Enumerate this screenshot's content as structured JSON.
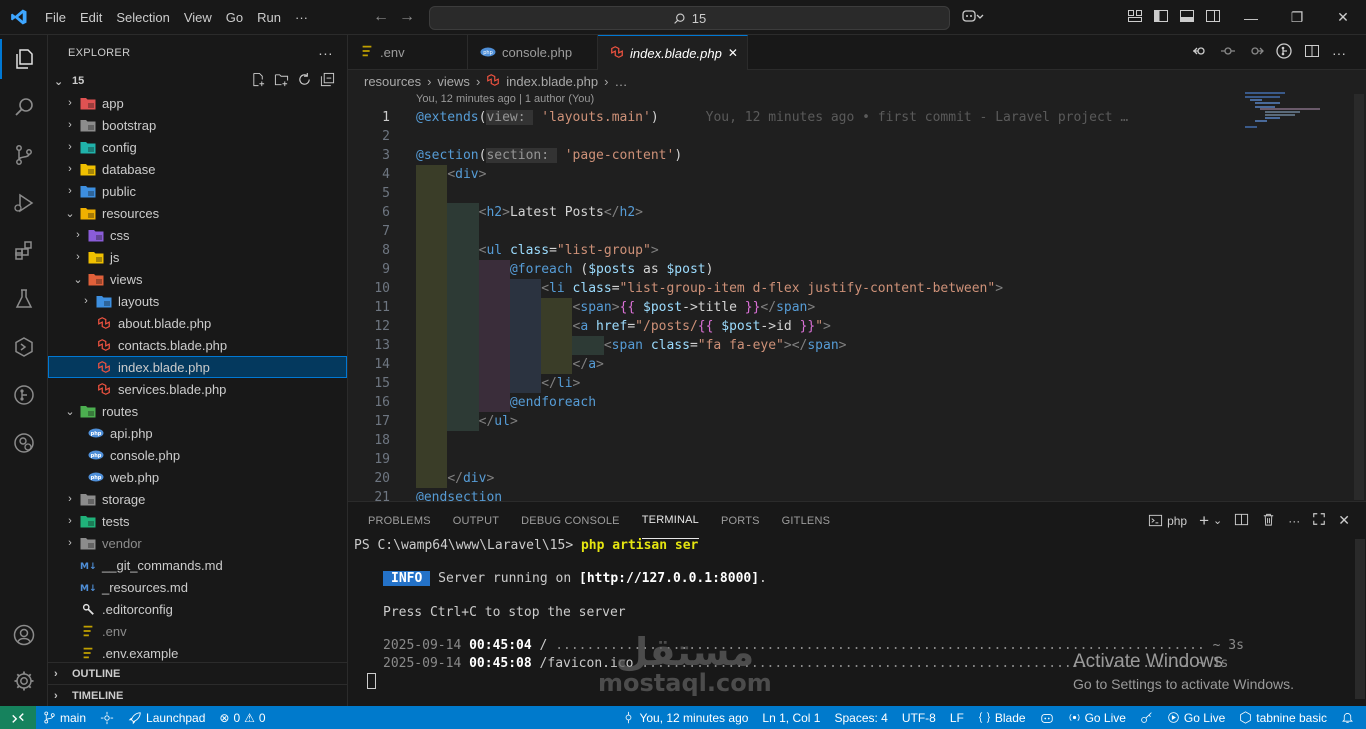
{
  "titlebar": {
    "menu": [
      "File",
      "Edit",
      "Selection",
      "View",
      "Go",
      "Run",
      "···"
    ],
    "search": "15"
  },
  "explorer": {
    "title": "EXPLORER",
    "more": "···",
    "root": "15",
    "items": [
      {
        "label": "app",
        "depth": 0,
        "chev": "›",
        "icon": "folder-app",
        "color": "#e05252"
      },
      {
        "label": "bootstrap",
        "depth": 0,
        "chev": "›",
        "icon": "folder",
        "color": "#8c8c8c"
      },
      {
        "label": "config",
        "depth": 0,
        "chev": "›",
        "icon": "folder-config",
        "color": "#20b2aa"
      },
      {
        "label": "database",
        "depth": 0,
        "chev": "›",
        "icon": "folder-database",
        "color": "#f0c000"
      },
      {
        "label": "public",
        "depth": 0,
        "chev": "›",
        "icon": "folder-public",
        "color": "#3d8fe0"
      },
      {
        "label": "resources",
        "depth": 0,
        "chev": "⌄",
        "icon": "folder-resources",
        "color": "#f0b000"
      },
      {
        "label": "css",
        "depth": 1,
        "chev": "›",
        "icon": "folder-css",
        "color": "#8a5cd8"
      },
      {
        "label": "js",
        "depth": 1,
        "chev": "›",
        "icon": "folder-js",
        "color": "#f0c000"
      },
      {
        "label": "views",
        "depth": 1,
        "chev": "⌄",
        "icon": "folder-views",
        "color": "#e0603a"
      },
      {
        "label": "layouts",
        "depth": 2,
        "chev": "›",
        "icon": "folder-layouts",
        "color": "#3d8fe0"
      },
      {
        "label": "about.blade.php",
        "depth": 2,
        "chev": "",
        "icon": "laravel",
        "color": "#f05340"
      },
      {
        "label": "contacts.blade.php",
        "depth": 2,
        "chev": "",
        "icon": "laravel",
        "color": "#f05340"
      },
      {
        "label": "index.blade.php",
        "depth": 2,
        "chev": "",
        "icon": "laravel",
        "color": "#f05340",
        "selected": true
      },
      {
        "label": "services.blade.php",
        "depth": 2,
        "chev": "",
        "icon": "laravel",
        "color": "#f05340"
      },
      {
        "label": "routes",
        "depth": 0,
        "chev": "⌄",
        "icon": "folder-routes",
        "color": "#4caf50"
      },
      {
        "label": "api.php",
        "depth": 1,
        "chev": "",
        "icon": "php",
        "color": "#4f8fd8"
      },
      {
        "label": "console.php",
        "depth": 1,
        "chev": "",
        "icon": "php",
        "color": "#4f8fd8"
      },
      {
        "label": "web.php",
        "depth": 1,
        "chev": "",
        "icon": "php",
        "color": "#4f8fd8"
      },
      {
        "label": "storage",
        "depth": 0,
        "chev": "›",
        "icon": "folder",
        "color": "#8c8c8c"
      },
      {
        "label": "tests",
        "depth": 0,
        "chev": "›",
        "icon": "folder-tests",
        "color": "#20b27a"
      },
      {
        "label": "vendor",
        "depth": 0,
        "chev": "›",
        "icon": "folder",
        "color": "#8c8c8c",
        "dim": true
      },
      {
        "label": "__git_commands.md",
        "depth": 0,
        "chev": "",
        "icon": "markdown",
        "color": "#4f8fd8"
      },
      {
        "label": "_resources.md",
        "depth": 0,
        "chev": "",
        "icon": "markdown",
        "color": "#4f8fd8"
      },
      {
        "label": ".editorconfig",
        "depth": 0,
        "chev": "",
        "icon": "editorconfig",
        "color": "#e0e0e0"
      },
      {
        "label": ".env",
        "depth": 0,
        "chev": "",
        "icon": "env",
        "color": "#c0a000",
        "dim": true
      },
      {
        "label": ".env.example",
        "depth": 0,
        "chev": "",
        "icon": "env",
        "color": "#c0a000"
      }
    ],
    "outline": "OUTLINE",
    "timeline": "TIMELINE"
  },
  "tabs": [
    {
      "label": ".env",
      "icon": "env",
      "active": false
    },
    {
      "label": "console.php",
      "icon": "php",
      "active": false
    },
    {
      "label": "index.blade.php",
      "icon": "laravel",
      "active": true,
      "close": "✕"
    }
  ],
  "breadcrumb": [
    "resources",
    "views",
    "index.blade.php",
    "…"
  ],
  "blame_header": "You, 12 minutes ago | 1 author (You)",
  "code": [
    {
      "n": "1",
      "indent": 0,
      "cur": true,
      "seg": [
        [
          "c-at",
          "@extends"
        ],
        [
          "c-txt",
          "("
        ],
        [
          "c-hint",
          "view: "
        ],
        [
          "c-str",
          " 'layouts.main'"
        ],
        [
          "c-txt",
          ")"
        ],
        [
          "c-blame",
          "      You, 12 minutes ago • first commit - Laravel project …"
        ]
      ]
    },
    {
      "n": "2",
      "indent": 0,
      "seg": []
    },
    {
      "n": "3",
      "indent": 0,
      "seg": [
        [
          "c-at",
          "@section"
        ],
        [
          "c-txt",
          "("
        ],
        [
          "c-hint",
          "section: "
        ],
        [
          "c-str",
          " 'page-content'"
        ],
        [
          "c-txt",
          ")"
        ]
      ]
    },
    {
      "n": "4",
      "indent": 1,
      "seg": [
        [
          "c-sp",
          "    "
        ],
        [
          "c-tag",
          "<"
        ],
        [
          "c-tn",
          "div"
        ],
        [
          "c-tag",
          ">"
        ]
      ]
    },
    {
      "n": "5",
      "indent": 1,
      "seg": []
    },
    {
      "n": "6",
      "indent": 2,
      "seg": [
        [
          "c-sp",
          "        "
        ],
        [
          "c-tag",
          "<"
        ],
        [
          "c-tn",
          "h2"
        ],
        [
          "c-tag",
          ">"
        ],
        [
          "c-txt",
          "Latest Posts"
        ],
        [
          "c-tag",
          "</"
        ],
        [
          "c-tn",
          "h2"
        ],
        [
          "c-tag",
          ">"
        ]
      ]
    },
    {
      "n": "7",
      "indent": 2,
      "seg": []
    },
    {
      "n": "8",
      "indent": 2,
      "seg": [
        [
          "c-sp",
          "        "
        ],
        [
          "c-tag",
          "<"
        ],
        [
          "c-tn",
          "ul "
        ],
        [
          "c-attr",
          "class"
        ],
        [
          "c-txt",
          "="
        ],
        [
          "c-str",
          "\"list-group\""
        ],
        [
          "c-tag",
          ">"
        ]
      ]
    },
    {
      "n": "9",
      "indent": 3,
      "seg": [
        [
          "c-sp",
          "            "
        ],
        [
          "c-at",
          "@foreach "
        ],
        [
          "c-txt",
          "("
        ],
        [
          "c-var",
          "$posts"
        ],
        [
          "c-txt",
          " as "
        ],
        [
          "c-var",
          "$post"
        ],
        [
          "c-txt",
          ")"
        ]
      ]
    },
    {
      "n": "10",
      "indent": 4,
      "seg": [
        [
          "c-sp",
          "                "
        ],
        [
          "c-tag",
          "<"
        ],
        [
          "c-tn",
          "li "
        ],
        [
          "c-attr",
          "class"
        ],
        [
          "c-txt",
          "="
        ],
        [
          "c-str",
          "\"list-group-item d-flex justify-content-between\""
        ],
        [
          "c-tag",
          ">"
        ]
      ]
    },
    {
      "n": "11",
      "indent": 5,
      "seg": [
        [
          "c-sp",
          "                    "
        ],
        [
          "c-tag",
          "<"
        ],
        [
          "c-tn",
          "span"
        ],
        [
          "c-tag",
          ">"
        ],
        [
          "c-br",
          "{{"
        ],
        [
          "c-txt",
          " "
        ],
        [
          "c-var",
          "$post"
        ],
        [
          "c-txt",
          "->title "
        ],
        [
          "c-br",
          "}}"
        ],
        [
          "c-tag",
          "</"
        ],
        [
          "c-tn",
          "span"
        ],
        [
          "c-tag",
          ">"
        ]
      ]
    },
    {
      "n": "12",
      "indent": 5,
      "seg": [
        [
          "c-sp",
          "                    "
        ],
        [
          "c-tag",
          "<"
        ],
        [
          "c-tn",
          "a "
        ],
        [
          "c-attr",
          "href"
        ],
        [
          "c-txt",
          "="
        ],
        [
          "c-str",
          "\"/posts/"
        ],
        [
          "c-br",
          "{{"
        ],
        [
          "c-txt",
          " "
        ],
        [
          "c-var",
          "$post"
        ],
        [
          "c-txt",
          "->id "
        ],
        [
          "c-br",
          "}}"
        ],
        [
          "c-str",
          "\""
        ],
        [
          "c-tag",
          ">"
        ]
      ]
    },
    {
      "n": "13",
      "indent": 6,
      "seg": [
        [
          "c-sp",
          "                        "
        ],
        [
          "c-tag",
          "<"
        ],
        [
          "c-tn",
          "span "
        ],
        [
          "c-attr",
          "class"
        ],
        [
          "c-txt",
          "="
        ],
        [
          "c-str",
          "\"fa fa-eye\""
        ],
        [
          "c-tag",
          "></"
        ],
        [
          "c-tn",
          "span"
        ],
        [
          "c-tag",
          ">"
        ]
      ]
    },
    {
      "n": "14",
      "indent": 5,
      "seg": [
        [
          "c-sp",
          "                    "
        ],
        [
          "c-tag",
          "</"
        ],
        [
          "c-tn",
          "a"
        ],
        [
          "c-tag",
          ">"
        ]
      ]
    },
    {
      "n": "15",
      "indent": 4,
      "seg": [
        [
          "c-sp",
          "                "
        ],
        [
          "c-tag",
          "</"
        ],
        [
          "c-tn",
          "li"
        ],
        [
          "c-tag",
          ">"
        ]
      ]
    },
    {
      "n": "16",
      "indent": 3,
      "seg": [
        [
          "c-sp",
          "            "
        ],
        [
          "c-at",
          "@endforeach"
        ]
      ]
    },
    {
      "n": "17",
      "indent": 2,
      "seg": [
        [
          "c-sp",
          "        "
        ],
        [
          "c-tag",
          "</"
        ],
        [
          "c-tn",
          "ul"
        ],
        [
          "c-tag",
          ">"
        ]
      ]
    },
    {
      "n": "18",
      "indent": 1,
      "seg": []
    },
    {
      "n": "19",
      "indent": 1,
      "seg": []
    },
    {
      "n": "20",
      "indent": 1,
      "seg": [
        [
          "c-sp",
          "    "
        ],
        [
          "c-tag",
          "</"
        ],
        [
          "c-tn",
          "div"
        ],
        [
          "c-tag",
          ">"
        ]
      ]
    },
    {
      "n": "21",
      "indent": 0,
      "seg": [
        [
          "c-at",
          "@endsection"
        ]
      ]
    }
  ],
  "indent_colors": [
    "#3a3d28",
    "#2d3a35",
    "#3a2d3a",
    "#2b3340",
    "#3a3d28",
    "#2d3a35"
  ],
  "panel": {
    "tabs": [
      "PROBLEMS",
      "OUTPUT",
      "DEBUG CONSOLE",
      "TERMINAL",
      "PORTS",
      "GITLENS"
    ],
    "active_tab": "TERMINAL",
    "shell": "php",
    "terminal": {
      "prompt": "PS C:\\wamp64\\www\\Laravel\\15> ",
      "command": "php artisan ser",
      "info_badge": "INFO",
      "info_text": " Server running on ",
      "info_url": "[http://127.0.0.1:8000]",
      "info_end": ".",
      "stop_text": "Press Ctrl+C to stop the server",
      "log": [
        {
          "date": "2025-09-14 ",
          "time": "00:45:04",
          "path": " / ",
          "dots": "...................................................................................",
          "dur": " ~ 3s"
        },
        {
          "date": "2025-09-14 ",
          "time": "00:45:08",
          "path": " /favicon.ico ",
          "dots": "......................................................................",
          "dur": " ~ 1s"
        }
      ]
    }
  },
  "watermark": {
    "line1": "Activate Windows",
    "line2": "Go to Settings to activate Windows."
  },
  "logo": {
    "arabic": "مستقل",
    "latin": "mostaql.com"
  },
  "statusbar": {
    "remote_icon": "remote-icon",
    "branch": "main",
    "launchpad": "Launchpad",
    "errors": "0",
    "warnings": "0",
    "blame": "You, 12 minutes ago",
    "position": "Ln 1, Col 1",
    "spaces": "Spaces: 4",
    "encoding": "UTF-8",
    "eol": "LF",
    "language": "Blade",
    "golive1": "Go Live",
    "golive2": "Go Live",
    "tabnine": "tabnine basic"
  },
  "colors": {
    "accent": "#0078d4",
    "statusbar": "#007acc",
    "remote": "#16825d"
  }
}
